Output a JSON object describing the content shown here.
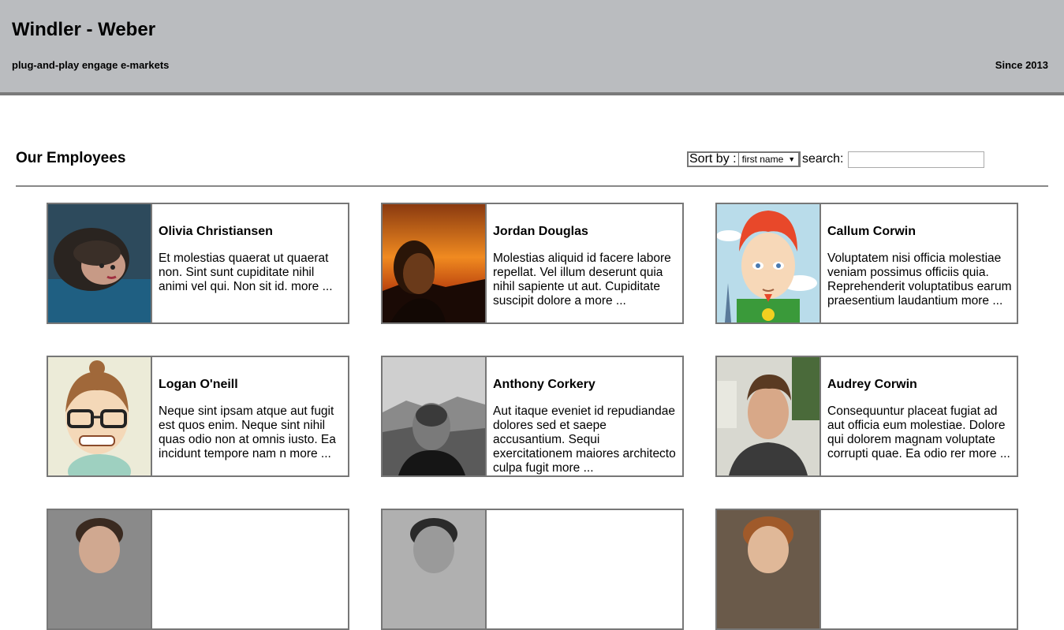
{
  "header": {
    "company": "Windler - Weber",
    "tagline": "plug-and-play engage e-markets",
    "since": "Since 2013"
  },
  "section": {
    "title": "Our Employees",
    "sort_label": "Sort by :",
    "sort_value": "first name",
    "search_label": "search:",
    "search_value": ""
  },
  "employees": [
    {
      "name": "Olivia Christiansen",
      "bio": "Et molestias quaerat ut quaerat non. Sint sunt cupiditate nihil animi vel qui. Non sit id. more ..."
    },
    {
      "name": "Jordan Douglas",
      "bio": "Molestias aliquid id facere labore repellat. Vel illum deserunt quia nihil sapiente ut aut. Cupiditate suscipit dolore a more ..."
    },
    {
      "name": "Callum Corwin",
      "bio": "Voluptatem nisi officia molestiae veniam possimus officiis quia. Reprehenderit voluptatibus earum praesentium laudantium more ..."
    },
    {
      "name": "Logan O'neill",
      "bio": "Neque sint ipsam atque aut fugit est quos enim. Neque sint nihil quas odio non at omnis iusto. Ea incidunt tempore nam n more ..."
    },
    {
      "name": "Anthony Corkery",
      "bio": "Aut itaque eveniet id repudiandae dolores sed et saepe accusantium. Sequi exercitationem maiores architecto culpa fugit more ..."
    },
    {
      "name": "Audrey Corwin",
      "bio": "Consequuntur placeat fugiat ad aut officia eum molestiae. Dolore qui dolorem magnam voluptate corrupti quae. Ea odio rer more ..."
    }
  ]
}
